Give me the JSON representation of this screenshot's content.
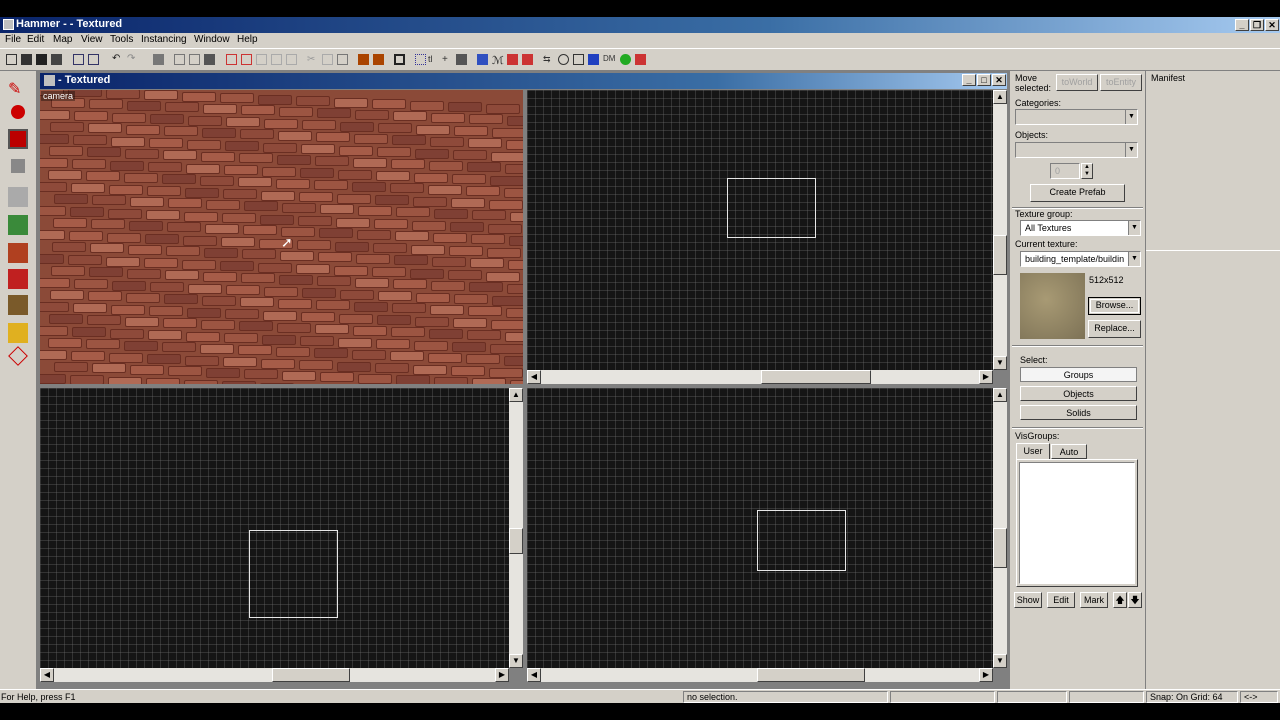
{
  "app_title": "Hammer - - Textured",
  "menu": [
    "File",
    "Edit",
    "Map",
    "View",
    "Tools",
    "Instancing",
    "Window",
    "Help"
  ],
  "child_window": {
    "title": "- Textured",
    "camera_label": "camera"
  },
  "right_panel": {
    "move_selected": "Move selected:",
    "to_world": "toWorld",
    "to_entity": "toEntity",
    "categories_label": "Categories:",
    "objects_label": "Objects:",
    "stepper_value": "0",
    "create_prefab": "Create Prefab",
    "texture_group_label": "Texture group:",
    "texture_group_value": "All Textures",
    "current_texture_label": "Current texture:",
    "current_texture_value": "building_template/buildin",
    "texture_size": "512x512",
    "browse": "Browse...",
    "replace": "Replace...",
    "select_label": "Select:",
    "groups": "Groups",
    "objects": "Objects",
    "solids": "Solids",
    "visgroups_label": "VisGroups:",
    "tab_user": "User",
    "tab_auto": "Auto",
    "show": "Show",
    "edit": "Edit",
    "mark": "Mark",
    "up_arrow": "🡅",
    "down_arrow": "🡇"
  },
  "manifest_label": "Manifest",
  "status": {
    "help": "For Help, press F1",
    "selection": "no selection.",
    "snap": "Snap: On Grid: 64",
    "arrows": "<->"
  },
  "colors": {
    "titlebar": "#0a246a",
    "panel": "#d4d0c8",
    "grid_bg": "#151515",
    "brick": "#9c5542"
  }
}
